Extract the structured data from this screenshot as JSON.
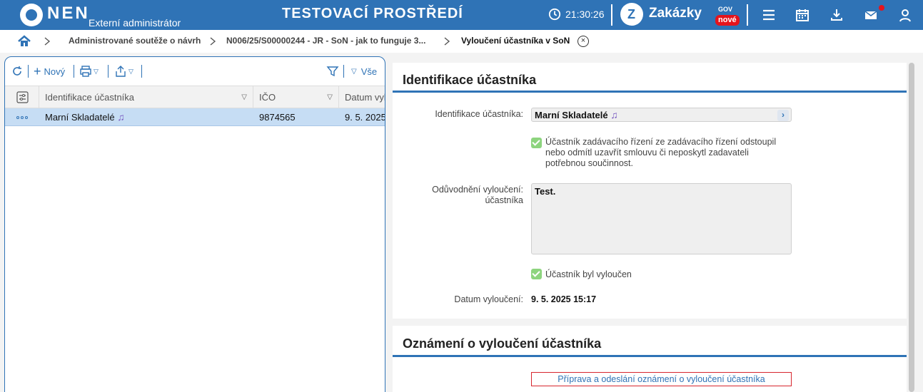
{
  "header": {
    "logo_text": "NEN",
    "logo_subtitle": "Externí administrátor",
    "environment_title": "TESTOVACÍ PROSTŘEDÍ",
    "time": "21:30:26",
    "zakazky_label": "Zakázky",
    "zakazky_gov": "GOV",
    "zakazky_badge": "nové",
    "icons": [
      "menu-icon",
      "calendar-icon",
      "download-icon",
      "mail-icon",
      "user-icon"
    ],
    "accent_color": "#2f73b6"
  },
  "breadcrumb": {
    "items": [
      "Administrované soutěže o návrh",
      "N006/25/S00000244 - JR - SoN - jak to funguje 3...",
      "Vyloučení účastníka v SoN"
    ]
  },
  "toolbar": {
    "new_label": "Nový",
    "filter_label": "Vše"
  },
  "grid": {
    "columns": [
      "Identifikace účastníka",
      "IČO",
      "Datum vyl"
    ],
    "rows": [
      {
        "name": "Marní Skladatelé",
        "ico": "9874565",
        "date": "9. 5. 2025"
      }
    ]
  },
  "identification": {
    "title": "Identifikace účastníka",
    "participant_label": "Identifikace účastníka:",
    "participant_value": "Marní Skladatelé",
    "withdraw_checkbox_label": "Účastník zadávacího řízení ze zadávacího řízení odstoupil nebo odmítl uzavřít smlouvu či neposkytl zadavateli potřebnou součinnost.",
    "reason_label_line1": "Odůvodnění vyloučení:",
    "reason_label_line2": "účastníka",
    "reason_value": "Test.",
    "excluded_checkbox_label": "Účastník byl vyloučen",
    "date_label": "Datum vyloučení:",
    "date_value": "9. 5. 2025 15:17"
  },
  "notification": {
    "title": "Oznámení o vyloučení účastníka",
    "button_label": "Příprava a odeslání oznámení o vyloučení účastníka"
  }
}
